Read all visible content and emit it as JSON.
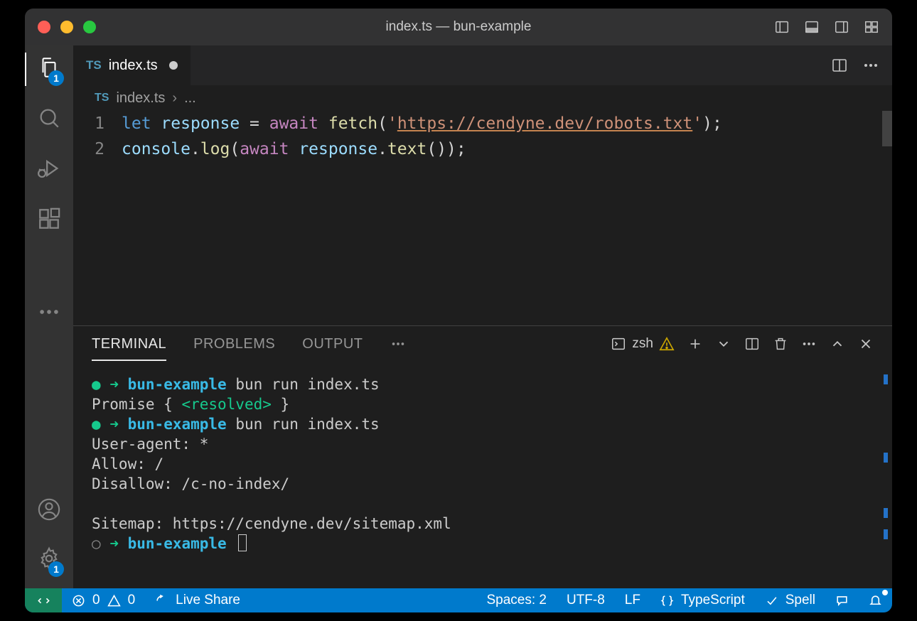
{
  "window": {
    "title": "index.ts — bun-example"
  },
  "activitybar": {
    "explorer_badge": "1",
    "settings_badge": "1"
  },
  "editor": {
    "tab": {
      "icon_text": "TS",
      "filename": "index.ts"
    },
    "breadcrumb": {
      "icon_text": "TS",
      "filename": "index.ts",
      "sep": "›",
      "more": "..."
    },
    "lines": [
      "1",
      "2"
    ],
    "code": {
      "l1": {
        "let": "let",
        "response": "response",
        "eq": " = ",
        "await": "await",
        "fetch": "fetch",
        "open": "(",
        "q1": "'",
        "url": "https://cendyne.dev/robots.txt",
        "q2": "'",
        "close": ")",
        "semi": ";"
      },
      "l2": {
        "console": "console",
        "dot1": ".",
        "log": "log",
        "open": "(",
        "await": "await",
        "sp": " ",
        "response": "response",
        "dot2": ".",
        "text": "text",
        "parens": "()",
        "close": ")",
        "semi": ";"
      }
    }
  },
  "panel": {
    "tabs": {
      "terminal": "TERMINAL",
      "problems": "PROBLEMS",
      "output": "OUTPUT"
    },
    "zsh": "zsh",
    "terminal_lines": {
      "prompt1_dir": "bun-example",
      "prompt1_cmd": " bun run index.ts",
      "promise_open": "Promise { ",
      "resolved": "<resolved>",
      "promise_close": " }",
      "prompt2_dir": "bun-example",
      "prompt2_cmd": " bun run index.ts",
      "ua": "User-agent: *",
      "allow": "Allow: /",
      "disallow": "Disallow: /c-no-index/",
      "sitemap": "Sitemap: https://cendyne.dev/sitemap.xml",
      "prompt3_dir": "bun-example"
    }
  },
  "statusbar": {
    "errors": "0",
    "warnings": "0",
    "liveshare": "Live Share",
    "spaces": "Spaces: 2",
    "encoding": "UTF-8",
    "eol": "LF",
    "lang": "TypeScript",
    "spell": "Spell"
  }
}
